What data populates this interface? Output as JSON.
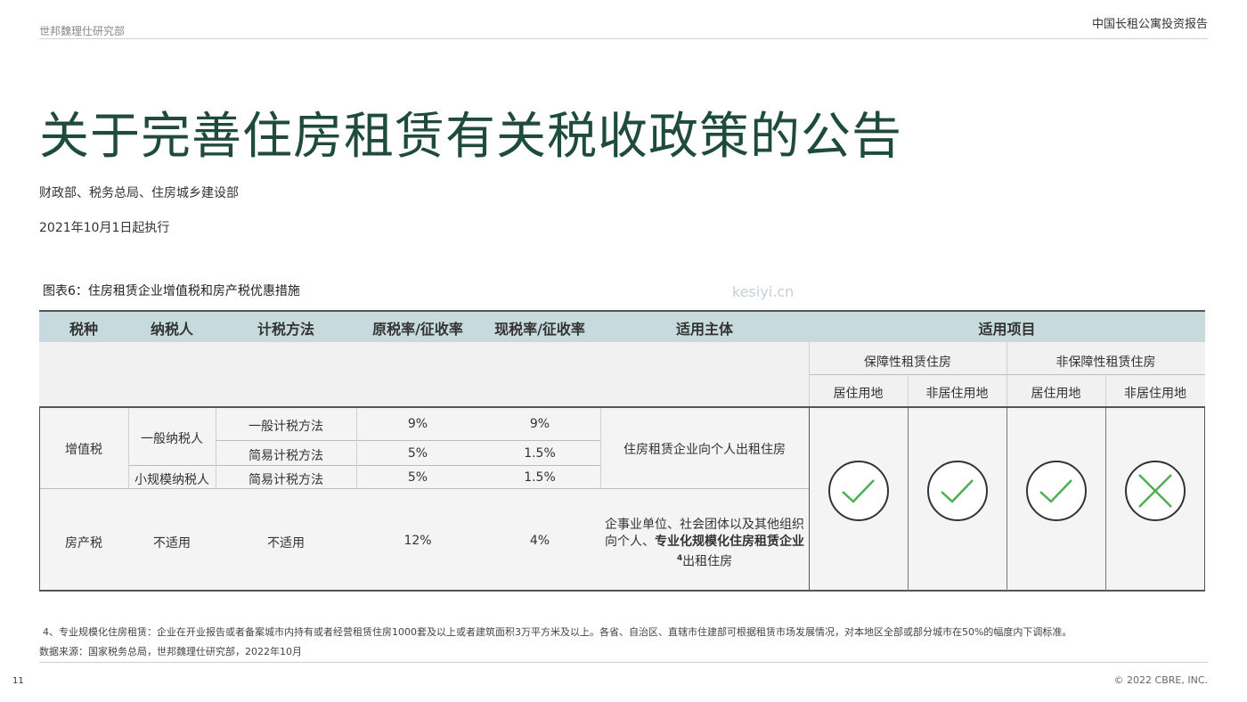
{
  "header": {
    "org": "世邦魏理仕研究部",
    "report": "中国长租公寓投资报告"
  },
  "title": "关于完善住房租赁有关税收政策的公告",
  "issuer": "财政部、税务总局、住房城乡建设部",
  "effective": "2021年10月1日起执行",
  "caption": "图表6：住房租赁企业增值税和房产税优惠措施",
  "table": {
    "headers": [
      "税种",
      "纳税人",
      "计税方法",
      "原税率/征收率",
      "现税率/征收率",
      "适用主体",
      "适用项目"
    ],
    "groups": [
      "保障性租赁住房",
      "非保障性租赁住房"
    ],
    "land": [
      "居住用地",
      "非居住用地",
      "居住用地",
      "非居住用地"
    ],
    "vat": {
      "tax": "增值税",
      "payer_general": "一般纳税人",
      "payer_small": "小规模纳税人",
      "rows": [
        {
          "method": "一般计税方法",
          "orig": "9%",
          "now": "9%"
        },
        {
          "method": "简易计税方法",
          "orig": "5%",
          "now": "1.5%"
        },
        {
          "method": "简易计税方法",
          "orig": "5%",
          "now": "1.5%"
        }
      ],
      "subject": "住房租赁企业向个人出租住房"
    },
    "property": {
      "tax": "房产税",
      "payer": "不适用",
      "method": "不适用",
      "orig": "12%",
      "now": "4%",
      "subject_a": "企事业单位、社会团体以及其他组织向个人、",
      "subject_bold": "专业化规模化住房租赁企业",
      "subject_sup": "4",
      "subject_b": "出租住房"
    },
    "applicability": [
      "check",
      "check",
      "check",
      "cross"
    ]
  },
  "footnote": "4、专业规模化住房租赁：企业在开业报告或者备案城市内持有或者经营租赁住房1000套及以上或者建筑面积3万平方米及以上。各省、自治区、直辖市住建部可根据租赁市场发展情况，对本地区全部或部分城市在50%的幅度内下调标准。",
  "source": "数据来源：国家税务总局，世邦魏理仕研究部，2022年10月",
  "page_number": "11",
  "copyright": "© 2022 CBRE, INC.",
  "watermark": "kesiyi.cn",
  "colors": {
    "title": "#1e4b3a",
    "header_band": "#c7dbde",
    "check": "#4caf50",
    "cross": "#4caf50"
  }
}
